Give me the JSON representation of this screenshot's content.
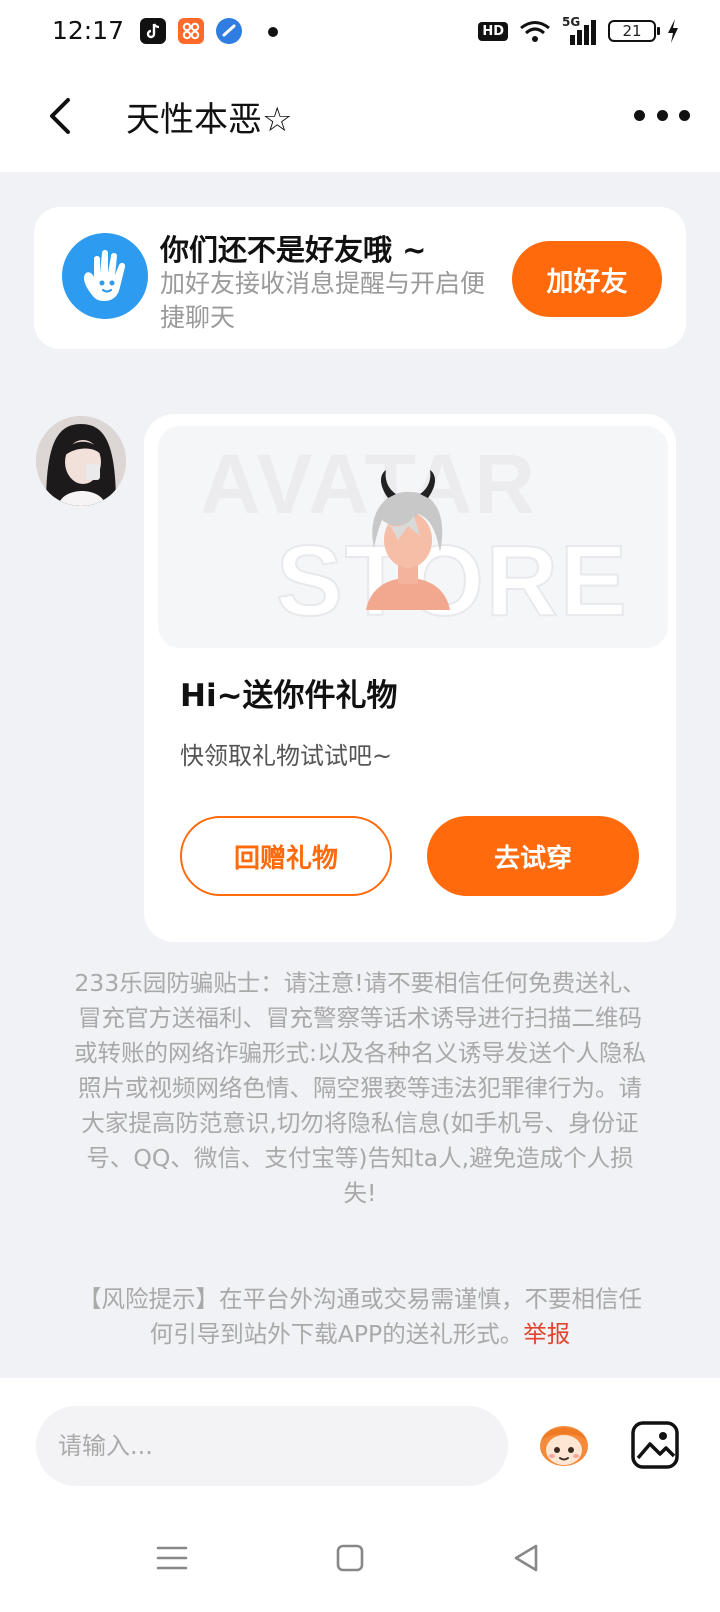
{
  "status_bar": {
    "time": "12:17",
    "hd_label": "HD",
    "network_label": "5G",
    "battery": "21"
  },
  "header": {
    "title": "天性本恶☆"
  },
  "friend_prompt": {
    "title": "你们还不是好友哦 ~",
    "subtitle": "加好友接收消息提醒与开启便捷聊天",
    "add_button": "加好友"
  },
  "gift_message": {
    "banner_watermark_line1": "AVATAR",
    "banner_watermark_line2": "STORE",
    "heading": "Hi~送你件礼物",
    "subtext": "快领取礼物试试吧~",
    "return_gift_button": "回赠礼物",
    "try_on_button": "去试穿"
  },
  "notices": {
    "fraud_tip": "233乐园防骗贴士：请注意!请不要相信任何免费送礼、冒充官方送福利、冒充警察等话术诱导进行扫描二维码或转账的网络诈骗形式:以及各种名义诱导发送个人隐私照片或视频网络色情、隔空猥亵等违法犯罪律行为。请大家提高防范意识,切勿将隐私信息(如手机号、身份证号、QQ、微信、支付宝等)告知ta人,避免造成个人损失!",
    "risk_tip": "【风险提示】在平台外沟通或交易需谨慎，不要相信任何引导到站外下载APP的送礼形式。",
    "report_link": "举报"
  },
  "composer": {
    "placeholder": "请输入..."
  },
  "colors": {
    "accent": "#ff6a0c",
    "friend_icon": "#2d9bef",
    "report": "#e3432e"
  }
}
